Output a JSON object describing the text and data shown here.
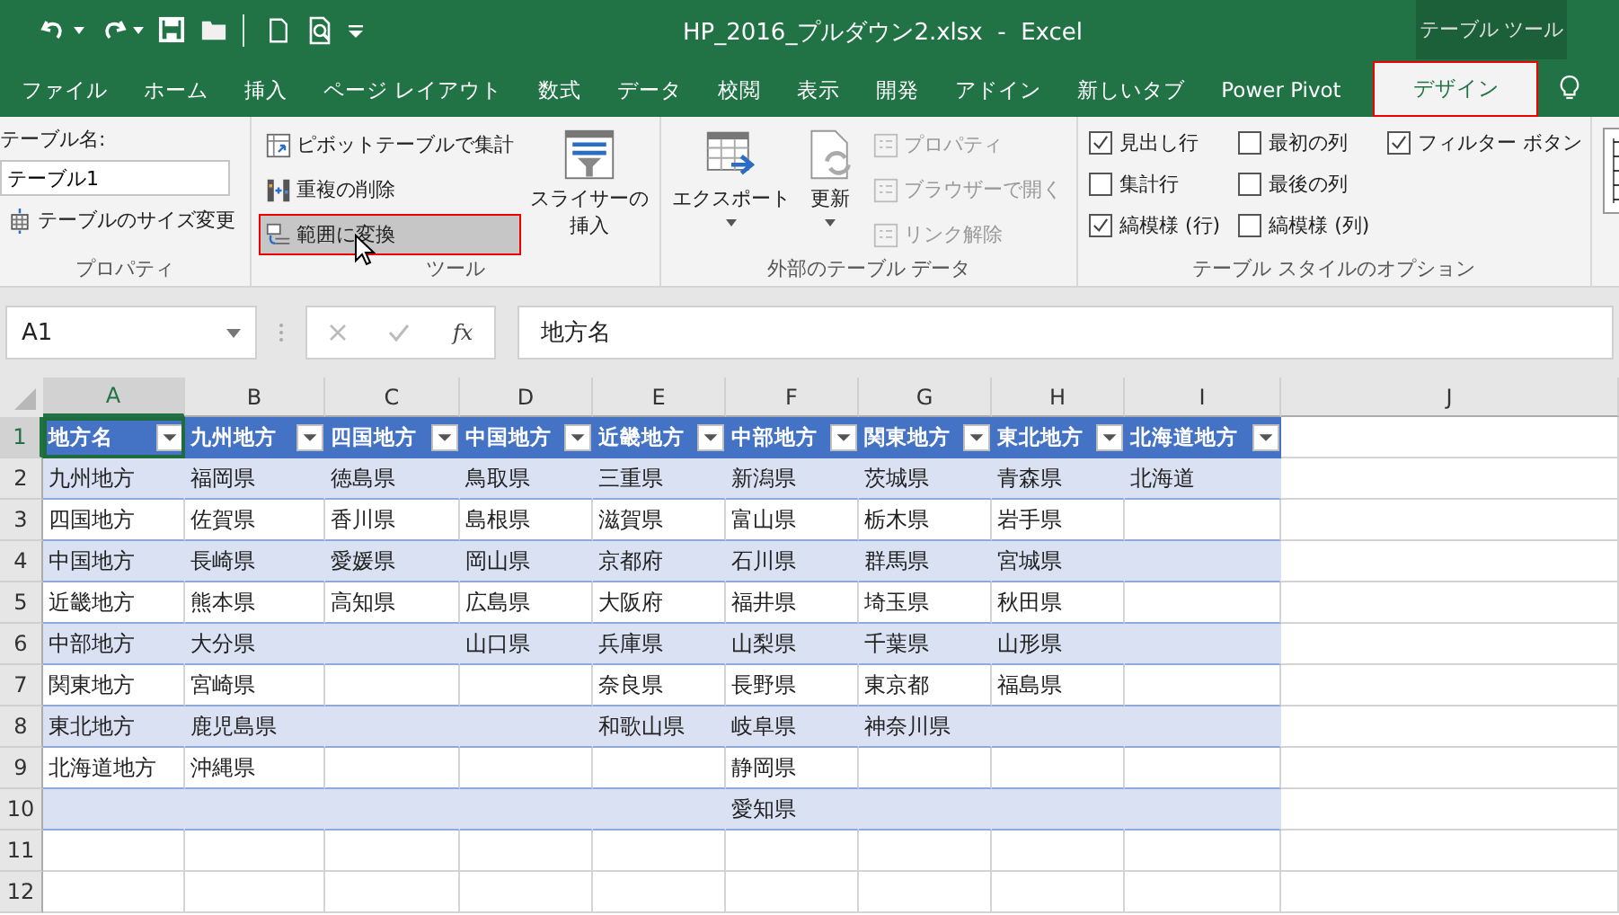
{
  "window": {
    "title": "HP_2016_プルダウン2.xlsx  -  Excel",
    "context_group": "テーブル ツール"
  },
  "tabs": [
    {
      "label": "ファイル",
      "selected": false,
      "highlighted": false
    },
    {
      "label": "ホーム",
      "selected": false,
      "highlighted": false
    },
    {
      "label": "挿入",
      "selected": false,
      "highlighted": false
    },
    {
      "label": "ページ レイアウト",
      "selected": false,
      "highlighted": false
    },
    {
      "label": "数式",
      "selected": false,
      "highlighted": false
    },
    {
      "label": "データ",
      "selected": false,
      "highlighted": false
    },
    {
      "label": "校閲",
      "selected": false,
      "highlighted": false
    },
    {
      "label": "表示",
      "selected": false,
      "highlighted": false
    },
    {
      "label": "開発",
      "selected": false,
      "highlighted": false
    },
    {
      "label": "アドイン",
      "selected": false,
      "highlighted": false
    },
    {
      "label": "新しいタブ",
      "selected": false,
      "highlighted": false
    },
    {
      "label": "Power Pivot",
      "selected": false,
      "highlighted": false
    },
    {
      "label": "デザイン",
      "selected": true,
      "highlighted": true
    }
  ],
  "ribbon": {
    "properties": {
      "name_label": "テーブル名:",
      "name_value": "テーブル1",
      "resize_button": "テーブルのサイズ変更",
      "group_label": "プロパティ"
    },
    "tools": {
      "buttons": [
        {
          "label": "ピボットテーブルで集計",
          "hovered": false,
          "highlighted": false
        },
        {
          "label": "重複の削除",
          "hovered": false,
          "highlighted": false
        },
        {
          "label": "範囲に変換",
          "hovered": true,
          "highlighted": true
        }
      ],
      "slicer_lines": [
        "スライサーの",
        "挿入"
      ],
      "group_label": "ツール"
    },
    "external": {
      "big_buttons": [
        {
          "label": "エクスポート",
          "disabled": false
        },
        {
          "label": "更新",
          "disabled": false
        }
      ],
      "small_buttons": [
        {
          "label": "プロパティ",
          "disabled": true
        },
        {
          "label": "ブラウザーで開く",
          "disabled": true
        },
        {
          "label": "リンク解除",
          "disabled": true
        }
      ],
      "group_label": "外部のテーブル データ"
    },
    "style_options": {
      "columns": [
        [
          {
            "label": "見出し行",
            "checked": true
          },
          {
            "label": "集計行",
            "checked": false
          },
          {
            "label": "縞模様 (行)",
            "checked": true
          }
        ],
        [
          {
            "label": "最初の列",
            "checked": false
          },
          {
            "label": "最後の列",
            "checked": false
          },
          {
            "label": "縞模様 (列)",
            "checked": false
          }
        ],
        [
          {
            "label": "フィルター ボタン",
            "checked": true
          }
        ]
      ],
      "group_label": "テーブル スタイルのオプション"
    }
  },
  "formula_bar": {
    "name_box": "A1",
    "function_label": "fx",
    "formula": "地方名"
  },
  "sheet": {
    "columns": [
      {
        "label": "A",
        "selected": true
      },
      {
        "label": "B",
        "selected": false
      },
      {
        "label": "C",
        "selected": false
      },
      {
        "label": "D",
        "selected": false
      },
      {
        "label": "E",
        "selected": false
      },
      {
        "label": "F",
        "selected": false
      },
      {
        "label": "G",
        "selected": false
      },
      {
        "label": "H",
        "selected": false
      },
      {
        "label": "I",
        "selected": false
      },
      {
        "label": "J",
        "selected": false
      }
    ],
    "rows": [
      {
        "label": "1",
        "selected": true
      },
      {
        "label": "2",
        "selected": false
      },
      {
        "label": "3",
        "selected": false
      },
      {
        "label": "4",
        "selected": false
      },
      {
        "label": "5",
        "selected": false
      },
      {
        "label": "6",
        "selected": false
      },
      {
        "label": "7",
        "selected": false
      },
      {
        "label": "8",
        "selected": false
      },
      {
        "label": "9",
        "selected": false
      },
      {
        "label": "10",
        "selected": false
      },
      {
        "label": "11",
        "selected": false
      },
      {
        "label": "12",
        "selected": false
      }
    ],
    "table": {
      "headers": [
        "地方名",
        "九州地方",
        "四国地方",
        "中国地方",
        "近畿地方",
        "中部地方",
        "関東地方",
        "東北地方",
        "北海道地方"
      ],
      "rows": [
        [
          "九州地方",
          "福岡県",
          "徳島県",
          "鳥取県",
          "三重県",
          "新潟県",
          "茨城県",
          "青森県",
          "北海道"
        ],
        [
          "四国地方",
          "佐賀県",
          "香川県",
          "島根県",
          "滋賀県",
          "富山県",
          "栃木県",
          "岩手県",
          null
        ],
        [
          "中国地方",
          "長崎県",
          "愛媛県",
          "岡山県",
          "京都府",
          "石川県",
          "群馬県",
          "宮城県",
          null
        ],
        [
          "近畿地方",
          "熊本県",
          "高知県",
          "広島県",
          "大阪府",
          "福井県",
          "埼玉県",
          "秋田県",
          null
        ],
        [
          "中部地方",
          "大分県",
          null,
          "山口県",
          "兵庫県",
          "山梨県",
          "千葉県",
          "山形県",
          null
        ],
        [
          "関東地方",
          "宮崎県",
          null,
          null,
          "奈良県",
          "長野県",
          "東京都",
          "福島県",
          null
        ],
        [
          "東北地方",
          "鹿児島県",
          null,
          null,
          "和歌山県",
          "岐阜県",
          "神奈川県",
          null,
          null
        ],
        [
          "北海道地方",
          "沖縄県",
          null,
          null,
          null,
          "静岡県",
          null,
          null,
          null
        ],
        [
          null,
          null,
          null,
          null,
          null,
          "愛知県",
          null,
          null,
          null
        ]
      ]
    }
  }
}
